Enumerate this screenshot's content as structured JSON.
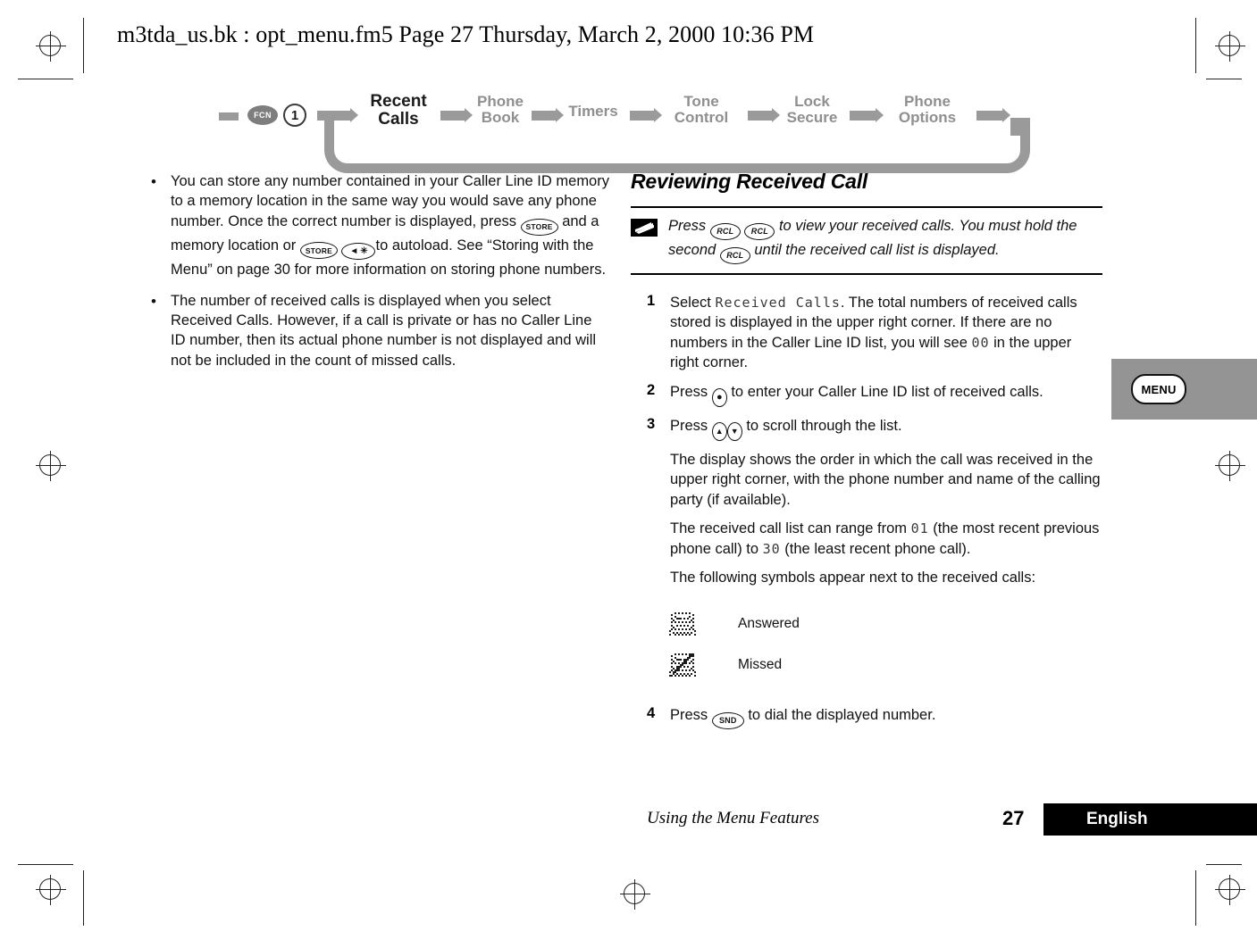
{
  "header": {
    "text": "m3tda_us.bk : opt_menu.fm5  Page 27  Thursday, March 2, 2000  10:36 PM"
  },
  "breadcrumb": {
    "fcn_key": "FCN",
    "number_key": "1",
    "items": [
      {
        "label": "Recent\nCalls",
        "active": true
      },
      {
        "label": "Phone\nBook",
        "active": false
      },
      {
        "label": "Timers",
        "active": false
      },
      {
        "label": "Tone\nControl",
        "active": false
      },
      {
        "label": "Lock\nSecure",
        "active": false
      },
      {
        "label": "Phone\nOptions",
        "active": false
      }
    ]
  },
  "left_column": {
    "bullets": [
      {
        "part1": "You can store any number contained in your Caller Line ID memory to a memory location in the same way you would save any phone number. Once the correct number is displayed, press ",
        "key1": "STORE",
        "part2": " and a memory location or ",
        "key2": "STORE",
        "key3_arrow": "◄",
        "key3_star": "✳",
        "part3": "to autoload. See “Storing with the Menu” on page 30 for more information on storing phone numbers."
      },
      {
        "text": "The number of received calls is displayed when you select Received Calls. However, if a call is private or has no Caller Line ID number, then its actual phone number is not displayed and will not be included in the count of missed calls."
      }
    ]
  },
  "right_column": {
    "section_title": "Reviewing Received Call",
    "note": {
      "icon": "lightning-bolt-icon",
      "part1": "Press ",
      "key1": "RCL",
      "key2": "RCL",
      "part2": " to view your received calls. You must hold the second ",
      "key3": "RCL",
      "part3": " until the received call list is displayed."
    },
    "steps": [
      {
        "num": "1",
        "part1": "Select ",
        "lcd1": "Received Calls",
        "part2": ". The total numbers of received calls stored is displayed in the upper right corner. If there are no numbers in the Caller Line ID list, you will see ",
        "lcd2": "00",
        "part3": " in the upper right corner."
      },
      {
        "num": "2",
        "part1": "Press ",
        "key": "●",
        "part2": " to enter your Caller Line ID list of received calls."
      },
      {
        "num": "3",
        "part1": "Press ",
        "key_up": "▲",
        "key_down": "▼",
        "part2": " to scroll through the list."
      }
    ],
    "paragraphs": [
      "The display shows the order in which the call was received in the upper right corner, with the phone number and name of the calling party (if available).",
      "The following symbols appear next to the received calls:"
    ],
    "range_paragraph": {
      "part1": "The received call list can range from ",
      "lcd1": "01",
      "part2": " (the most recent previous phone call) to ",
      "lcd2": "30",
      "part3": " (the least recent phone call)."
    },
    "symbols": [
      {
        "glyph": "phone-answered-icon",
        "label": "Answered"
      },
      {
        "glyph": "phone-missed-icon",
        "label": "Missed"
      }
    ],
    "step4": {
      "num": "4",
      "part1": "Press ",
      "key": "SND",
      "part2": " to dial the displayed number."
    }
  },
  "menu_tab": {
    "label": "MENU"
  },
  "footer": {
    "title": "Using the Menu Features",
    "page_number": "27",
    "language": "English"
  },
  "colors": {
    "breadcrumb_gray": "#9a9a9a",
    "inactive_label": "#8f8f8f",
    "tab_gray": "#949494",
    "lcd_text": "#3a3a3a"
  }
}
